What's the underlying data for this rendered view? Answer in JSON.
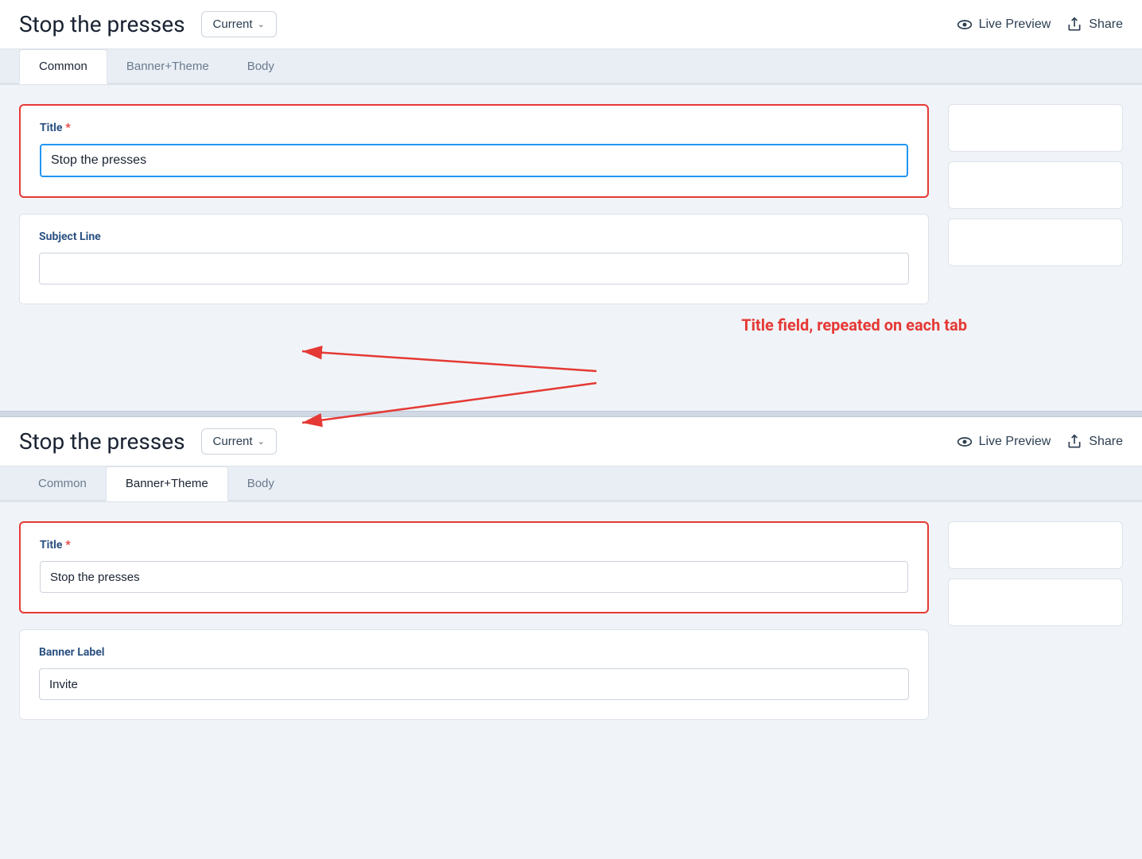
{
  "app": {
    "title": "Stop the presses"
  },
  "header": {
    "page_title": "Stop the presses",
    "version_label": "Current",
    "version_chevron": "∨",
    "live_preview_label": "Live Preview",
    "share_label": "Share"
  },
  "tabs_top": {
    "items": [
      {
        "id": "common",
        "label": "Common",
        "active": true
      },
      {
        "id": "banner-theme",
        "label": "Banner+Theme",
        "active": false
      },
      {
        "id": "body",
        "label": "Body",
        "active": false
      }
    ]
  },
  "top_form": {
    "title_label": "Title",
    "title_required": "*",
    "title_value": "Stop the presses",
    "subject_line_label": "Subject Line",
    "subject_line_value": ""
  },
  "annotation": {
    "text": "Title field, repeated on each tab"
  },
  "tabs_bottom": {
    "items": [
      {
        "id": "common",
        "label": "Common",
        "active": false
      },
      {
        "id": "banner-theme",
        "label": "Banner+Theme",
        "active": true
      },
      {
        "id": "body",
        "label": "Body",
        "active": false
      }
    ]
  },
  "bottom_form": {
    "title_label": "Title",
    "title_required": "*",
    "title_value": "Stop the presses",
    "banner_label": "Banner Label",
    "banner_value": "Invite"
  },
  "header2": {
    "page_title": "Stop the presses",
    "version_label": "Current",
    "live_preview_label": "Live Preview",
    "share_label": "Share"
  }
}
